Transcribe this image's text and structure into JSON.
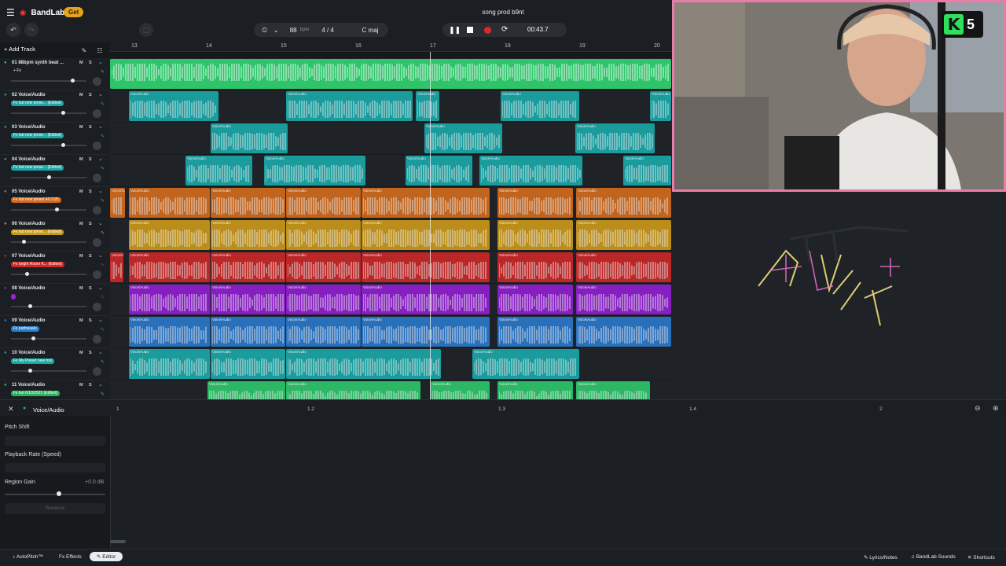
{
  "header": {
    "app_name": "BandLab",
    "get_badge": "Get",
    "song_title": "song prod b9nt",
    "bpm_value": "88",
    "bpm_unit": "bpm",
    "time_signature": "4 / 4",
    "key": "C maj",
    "time_display": "00:43.7"
  },
  "toolbar": {
    "add_track_label": "Add Track"
  },
  "ruler": {
    "bars": [
      "13",
      "14",
      "15",
      "16",
      "17",
      "18",
      "19",
      "20"
    ]
  },
  "tracks": [
    {
      "name": "01 88bpm synth beat ...",
      "tag": "+ Fx",
      "tag_color": ""
    },
    {
      "name": "02 Voice/Audio",
      "tag": "Fx kut new prese... (Edited)",
      "tag_color": "#19a7a7"
    },
    {
      "name": "03 Voice/Audio",
      "tag": "Fx kut new prese... (Edited)",
      "tag_color": "#19a7a7"
    },
    {
      "name": "04 Voice/Audio",
      "tag": "Fx kut new prese... (Edited)",
      "tag_color": "#19a7a7"
    },
    {
      "name": "05 Voice/Audio",
      "tag": "Fx kut new preset 4/17/25",
      "tag_color": "#d56a1e"
    },
    {
      "name": "06 Voice/Audio",
      "tag": "Fx kut new prese... (Edited)",
      "tag_color": "#c99a1a"
    },
    {
      "name": "07 Voice/Audio",
      "tag": "Fx bright Room K... (Edited)",
      "tag_color": "#cf2a2a"
    },
    {
      "name": "08 Voice/Audio",
      "tag": "",
      "tag_color": "#9a22d6"
    },
    {
      "name": "09 Voice/Audio",
      "tag": "Fx pathwaalo",
      "tag_color": "#2a7fd0"
    },
    {
      "name": "10 Voice/Audio",
      "tag": "Fx My Preset new mix",
      "tag_color": "#18a9a0"
    },
    {
      "name": "11 Voice/Audio",
      "tag": "Fx kut 6/10/2025 (Edited)",
      "tag_color": "#27b35e"
    }
  ],
  "track_controls": {
    "mute": "M",
    "solo": "S"
  },
  "region_label": "Voice/Audio",
  "editor": {
    "title": "Voice/Audio",
    "ruler": [
      "1",
      "1.2",
      "1.3",
      "1.4",
      "2"
    ],
    "pitch_shift_label": "Pitch Shift",
    "playback_rate_label": "Playback Rate (Speed)",
    "region_gain_label": "Region Gain",
    "region_gain_value": "+0.0 dB",
    "reverse_label": "Reverse",
    "region_gain_fraction": 0.54
  },
  "bottom": {
    "autopitch_label": "AutoPitch™",
    "effects_label": "Effects",
    "editor_label": "Editor",
    "lyrics_label": "Lyrics/Notes",
    "sounds_label": "BandLab Sounds",
    "shortcuts_label": "Shortcuts"
  },
  "overlay": {
    "badge_letter": "K",
    "badge_number": "5"
  },
  "colors": {
    "green": "#2ec46a",
    "teal": "#1aa6a6",
    "orange": "#cf6a1e",
    "gold": "#c9971a",
    "red": "#c92727",
    "purple": "#8f1ecf",
    "blue": "#2a77c8",
    "webcam_border": "#ea7ca8"
  }
}
